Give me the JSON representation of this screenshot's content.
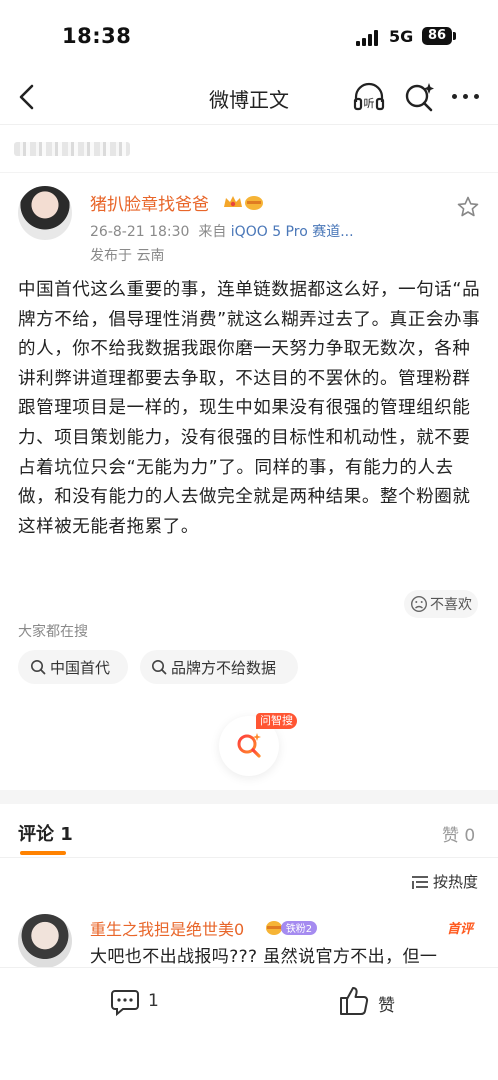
{
  "status_bar": {
    "time": "18:38",
    "network": "5G",
    "battery": "86"
  },
  "nav": {
    "title": "微博正文",
    "listen_icon_label": "听"
  },
  "post": {
    "author": "猪扒脸章找爸爸",
    "meta_date": "26-8-21 18:30",
    "meta_from": "来自",
    "meta_device": "iQOO 5 Pro 赛道...",
    "location": "发布于 云南",
    "text": "中国首代这么重要的事，连单链数据都这么好，一句话“品牌方不给，倡导理性消费”就这么糊弄过去了。真正会办事的人，你不给我数据我跟你磨一天努力争取无数次，各种讲利弊讲道理都要去争取，不达目的不罢休的。管理粉群跟管理项目是一样的，现生中如果没有很强的管理组织能力、项目策划能力，没有很强的目标性和机动性，就不要占着坑位只会“无能为力”了。同样的事，有能力的人去做，和没有能力的人去做完全就是两种结果。整个粉圈就这样被无能者拖累了。",
    "dislike_label": "不喜欢"
  },
  "hot_search": {
    "label": "大家都在搜",
    "chips": [
      "中国首代",
      "品牌方不给数据"
    ]
  },
  "ai_search": {
    "tag": "问智搜"
  },
  "comments_header": {
    "comments_tab": "评论 1",
    "likes_tab": "赞 0",
    "sort_label": "按热度"
  },
  "comment": {
    "author": "重生之我担是绝世美0",
    "badge": "铁粉2",
    "hot_tag": "首评",
    "text": "大吧也不出战报吗??? 虽然说官方不出，但一"
  },
  "bottom_bar": {
    "comment_count": "1",
    "like_label": "赞"
  },
  "colors": {
    "accent": "#ff8200",
    "username": "#e8662a",
    "hot": "#ff5533"
  }
}
